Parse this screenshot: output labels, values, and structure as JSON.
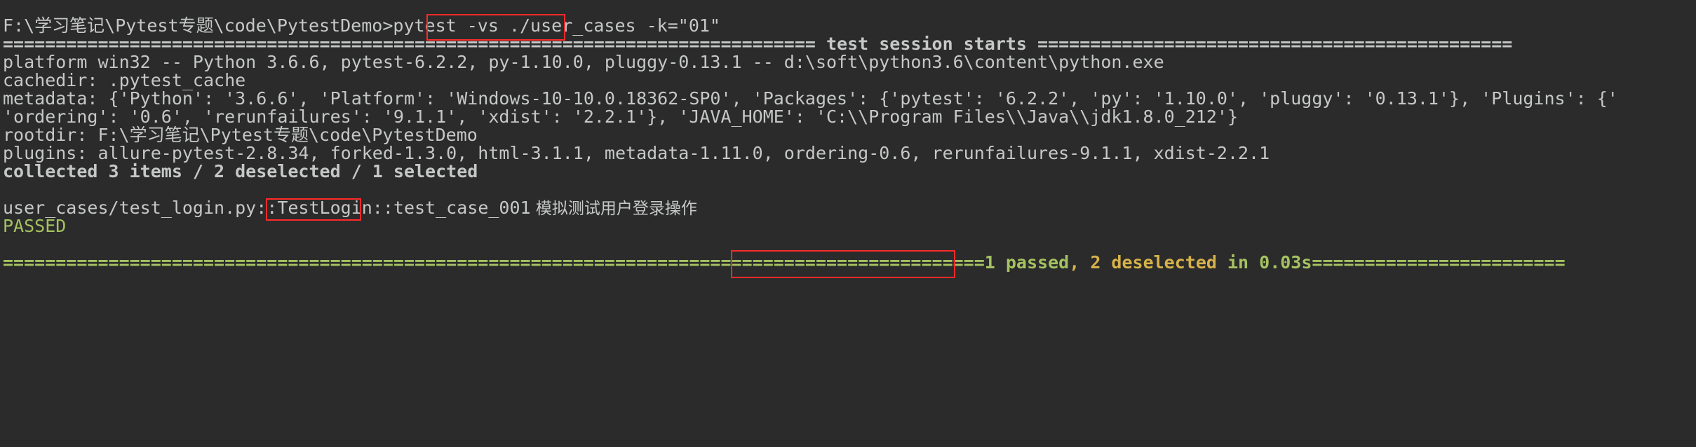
{
  "terminal": {
    "background_color": "#2b2b2b",
    "default_text_color": "#c5c8c6",
    "highlight_box_color": "#ff2a2a",
    "pass_color": "#a5c261",
    "warn_color": "#d6b24a",
    "prompt": "F:\\学习笔记\\Pytest专题\\code\\PytestDemo>",
    "command": "pytest -vs ./user_cases -k=\"01\"",
    "lines": {
      "session_header": "============================================================================= test session starts =============================================",
      "platform": "platform win32 -- Python 3.6.6, pytest-6.2.2, py-1.10.0, pluggy-0.13.1 -- d:\\soft\\python3.6\\content\\python.exe",
      "cachedir": "cachedir: .pytest_cache",
      "metadata_1": "metadata: {'Python': '3.6.6', 'Platform': 'Windows-10-10.0.18362-SP0', 'Packages': {'pytest': '6.2.2', 'py': '1.10.0', 'pluggy': '0.13.1'}, 'Plugins': {'",
      "metadata_2": "'ordering': '0.6', 'rerunfailures': '9.1.1', 'xdist': '2.2.1'}, 'JAVA_HOME': 'C:\\\\Program Files\\\\Java\\\\jdk1.8.0_212'}",
      "rootdir": "rootdir: F:\\学习笔记\\Pytest专题\\code\\PytestDemo",
      "plugins": "plugins: allure-pytest-2.8.34, forked-1.3.0, html-3.1.1, metadata-1.11.0, ordering-0.6, rerunfailures-9.1.1, xdist-2.2.1",
      "collected": "collected 3 items / 2 deselected / 1 selected",
      "test_path_prefix": "user_cases/test_login.py::TestLogin::",
      "test_case_name": "test_case_001",
      "test_case_desc": " 模拟测试用户登录操作",
      "passed": "PASSED",
      "summary_sep_left": "=============================================================================================",
      "summary_passed": "1 passed",
      "summary_comma": ", ",
      "summary_deselected": "2 deselected",
      "summary_time": " in 0.03s",
      "summary_sep_right": "========================"
    }
  }
}
